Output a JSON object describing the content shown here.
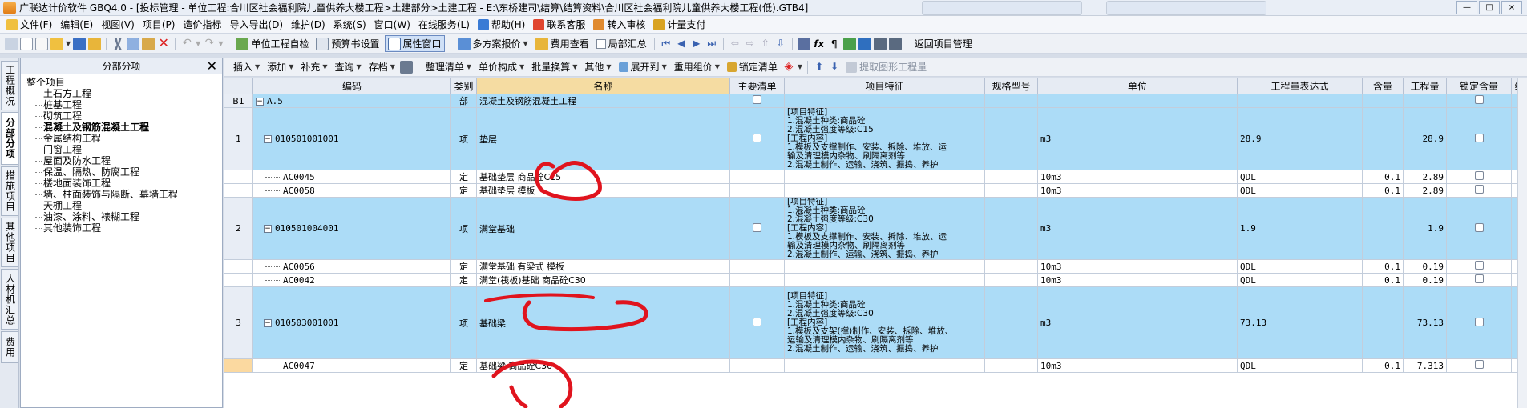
{
  "window": {
    "title": "广联达计价软件 GBQ4.0 - [投标管理 - 单位工程:合川区社会福利院儿童供养大楼工程>土建部分>土建工程 - E:\\东桥建司\\结算\\结算资料\\合川区社会福利院儿童供养大楼工程(低).GTB4]",
    "ghost_tabs": [
      "",
      ""
    ],
    "min_label": "—",
    "max_label": "□",
    "close_label": "×"
  },
  "menu": [
    {
      "label": "文件(F)",
      "color": "#f0c040"
    },
    {
      "label": "编辑(E)",
      "color": ""
    },
    {
      "label": "视图(V)",
      "color": ""
    },
    {
      "label": "项目(P)",
      "color": ""
    },
    {
      "label": "造价指标",
      "color": ""
    },
    {
      "label": "导入导出(D)",
      "color": ""
    },
    {
      "label": "维护(D)",
      "color": ""
    },
    {
      "label": "系统(S)",
      "color": ""
    },
    {
      "label": "窗口(W)",
      "color": ""
    },
    {
      "label": "在线服务(L)",
      "color": ""
    },
    {
      "label": "帮助(H)",
      "color": "#3a7bd5"
    },
    {
      "label": "联系客服",
      "color": "#e0452f"
    },
    {
      "label": "转入审核",
      "color": "#e08a2f"
    },
    {
      "label": "计量支付",
      "color": "#d9a321"
    }
  ],
  "toolbar1": {
    "unit_check": "单位工程自检",
    "budget_settings": "预算书设置",
    "property_window": "属性窗口",
    "multi_quote": "多方案报价",
    "fee_view": "费用查看",
    "local_summary": "局部汇总",
    "return_pm": "返回项目管理"
  },
  "toolbar2": {
    "insert": "插入",
    "add": "添加",
    "supplement": "补充",
    "query": "查询",
    "save": "存档",
    "organize": "整理清单",
    "unit_price": "单价构成",
    "batch_convert": "批量换算",
    "other": "其他",
    "expand_to": "展开到",
    "reuse": "重用组价",
    "lock": "锁定清单",
    "extract": "提取图形工程量"
  },
  "vtabs": [
    "工程概况",
    "分部分项",
    "措施项目",
    "其他项目",
    "人材机汇总",
    "费用"
  ],
  "tree": {
    "header": "分部分项",
    "close": "✕",
    "root": "整个项目",
    "children": [
      "土石方工程",
      "桩基工程",
      "砌筑工程",
      "混凝土及钢筋混凝土工程",
      "金属结构工程",
      "门窗工程",
      "屋面及防水工程",
      "保温、隔热、防腐工程",
      "楼地面装饰工程",
      "墙、柱面装饰与隔断、幕墙工程",
      "天棚工程",
      "油漆、涂料、裱糊工程",
      "其他装饰工程"
    ],
    "bold_index": 3
  },
  "grid": {
    "headers": [
      "",
      "编码",
      "类别",
      "名称",
      "主要清单",
      "项目特征",
      "规格型号",
      "单位",
      "工程量表达式",
      "含量",
      "工程量",
      "锁定含量",
      "综"
    ],
    "rows": [
      {
        "row": "B1",
        "code": "A.5",
        "type": "部",
        "name": "混凝土及钢筋混凝土工程",
        "feature": "",
        "unit": "",
        "expr": "",
        "content": "",
        "qty": "",
        "style": "blue",
        "level": "top",
        "h": 16
      },
      {
        "row": "1",
        "code": "010501001001",
        "type": "项",
        "name": "垫层",
        "feature": "[项目特征]\n1.混凝土种类:商品砼\n2.混凝土强度等级:C15\n[工程内容]\n1.模板及支撑制作、安装、拆除、堆放、运\n输及清理模内杂物、刷隔离剂等\n2.混凝土制作、运输、浇筑、振捣、养护",
        "unit": "m3",
        "expr": "28.9",
        "content": "",
        "qty": "28.9",
        "style": "blue",
        "level": "item",
        "h": 74
      },
      {
        "row": "",
        "code": "AC0045",
        "type": "定",
        "name": "基础垫层 商品砼C15",
        "feature": "",
        "unit": "10m3",
        "expr": "QDL",
        "content": "0.1",
        "qty": "2.89",
        "style": "white",
        "level": "sub",
        "h": 16
      },
      {
        "row": "",
        "code": "AC0058",
        "type": "定",
        "name": "基础垫层 模板",
        "feature": "",
        "unit": "10m3",
        "expr": "QDL",
        "content": "0.1",
        "qty": "2.89",
        "style": "white",
        "level": "sub",
        "h": 16
      },
      {
        "row": "2",
        "code": "010501004001",
        "type": "项",
        "name": "满堂基础",
        "feature": "[项目特征]\n1.混凝土种类:商品砼\n2.混凝土强度等级:C30\n[工程内容]\n1.模板及支撑制作、安装、拆除、堆放、运\n输及清理模内杂物、刷隔离剂等\n2.混凝土制作、运输、浇筑、振捣、养护",
        "unit": "m3",
        "expr": "1.9",
        "content": "",
        "qty": "1.9",
        "style": "blue",
        "level": "item",
        "h": 76
      },
      {
        "row": "",
        "code": "AC0056",
        "type": "定",
        "name": "满堂基础 有梁式 模板",
        "feature": "",
        "unit": "10m3",
        "expr": "QDL",
        "content": "0.1",
        "qty": "0.19",
        "style": "white",
        "level": "sub",
        "h": 16
      },
      {
        "row": "",
        "code": "AC0042",
        "type": "定",
        "name": "满堂(筏板)基础 商品砼C30",
        "feature": "",
        "unit": "10m3",
        "expr": "QDL",
        "content": "0.1",
        "qty": "0.19",
        "style": "white",
        "level": "sub",
        "h": 16
      },
      {
        "row": "3",
        "code": "010503001001",
        "type": "项",
        "name": "基础梁",
        "feature": "[项目特征]\n1.混凝土种类:商品砼\n2.混凝土强度等级:C30\n[工程内容]\n1.模板及支架(撑)制作、安装、拆除、堆放、\n运输及清理模内杂物、刷隔离剂等\n2.混凝土制作、运输、浇筑、振捣、养护",
        "unit": "m3",
        "expr": "73.13",
        "content": "",
        "qty": "73.13",
        "style": "blue",
        "level": "item",
        "h": 90
      },
      {
        "row": "",
        "code": "AC0047",
        "type": "定",
        "name": "基础梁 商品砼C30",
        "feature": "",
        "unit": "10m3",
        "expr": "QDL",
        "content": "0.1",
        "qty": "7.313",
        "style": "white",
        "level": "sub",
        "h": 17,
        "selected": true
      }
    ]
  },
  "colors": {
    "row_blue": "#acdcf7",
    "header_highlight": "#f5dca2",
    "annotation_red": "#e0141e"
  }
}
